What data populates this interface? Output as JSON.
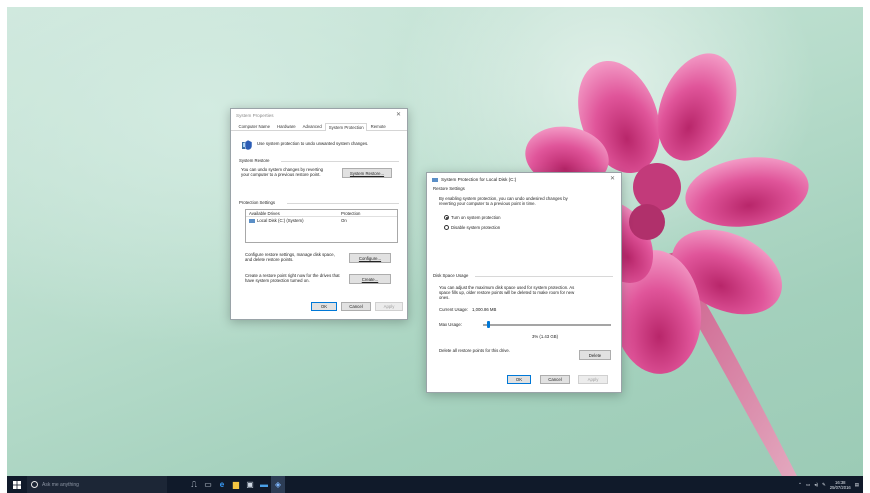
{
  "system_properties": {
    "title": "System Properties",
    "tabs": [
      "Computer Name",
      "Hardware",
      "Advanced",
      "System Protection",
      "Remote"
    ],
    "active_tab": "System Protection",
    "intro_text": "Use system protection to undo unwanted system changes.",
    "restore_group": "System Restore",
    "restore_text_1": "You can undo system changes by reverting",
    "restore_text_2": "your computer to a previous restore point.",
    "restore_button": "System Restore...",
    "protection_group": "Protection Settings",
    "columns": [
      "Available Drives",
      "Protection"
    ],
    "drives": [
      {
        "name": "Local Disk (C:) (System)",
        "protection": "On"
      }
    ],
    "configure_text_1": "Configure restore settings, manage disk space,",
    "configure_text_2": "and delete restore points.",
    "configure_button": "Configure...",
    "create_text_1": "Create a restore point right now for the drives that",
    "create_text_2": "have system protection turned on.",
    "create_button": "Create...",
    "ok": "OK",
    "cancel": "Cancel",
    "apply": "Apply"
  },
  "local_disk_dialog": {
    "title": "System Protection for Local Disk (C:)",
    "restore_settings_group": "Restore Settings",
    "restore_settings_text_1": "By enabling system protection, you can undo undesired changes by",
    "restore_settings_text_2": "reverting your computer to a previous point in time.",
    "radio_on": "Turn on system protection",
    "radio_off": "Disable system protection",
    "disk_usage_group": "Disk Space Usage",
    "disk_text_1": "You can adjust the maximum disk space used for system protection. As",
    "disk_text_2": "space fills up, older restore points will be deleted to make room for new",
    "disk_text_3": "ones.",
    "current_usage_label": "Current Usage:",
    "current_usage_value": "1,000.86 MB",
    "max_usage_label": "Max Usage:",
    "max_usage_fraction": 0.03,
    "max_usage_value": "3% (1.43 GB)",
    "delete_text": "Delete all restore points for this drive.",
    "delete_button": "Delete",
    "ok": "OK",
    "cancel": "Cancel",
    "apply": "Apply"
  },
  "taskbar": {
    "search_placeholder": "Ask me anything",
    "time": "16:38",
    "date": "25/07/2016"
  },
  "colors": {
    "accent": "#0078d7",
    "taskbar": "#101a2a",
    "flower": "#e0559a"
  }
}
